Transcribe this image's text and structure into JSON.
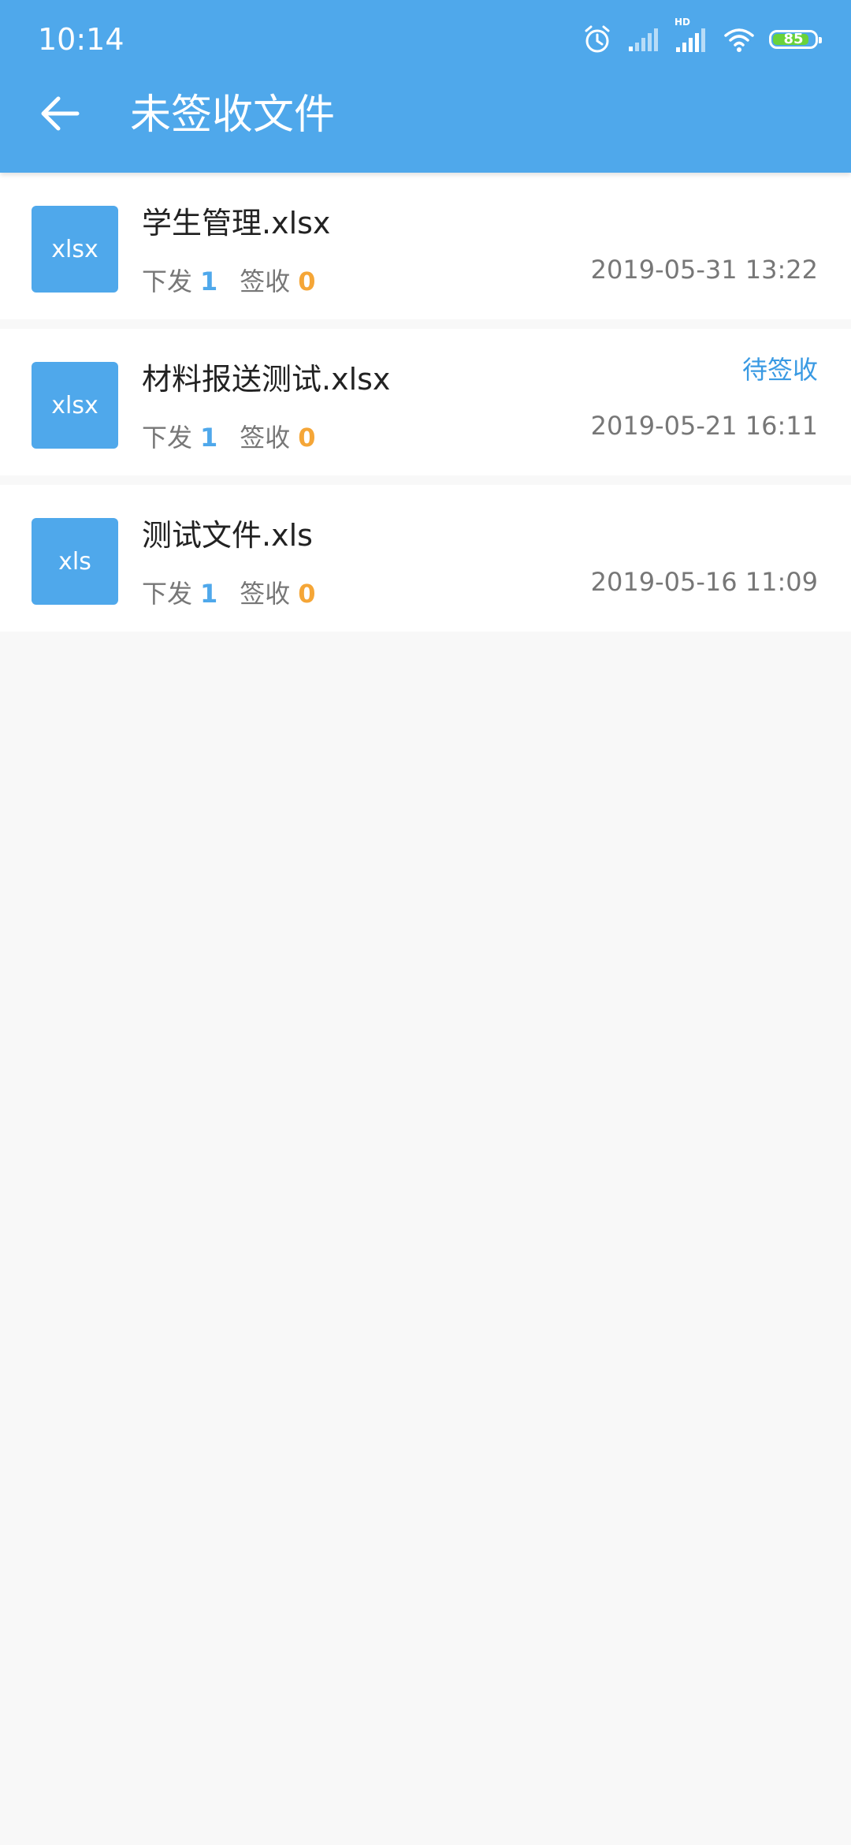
{
  "status_bar": {
    "time": "10:14",
    "battery": "85",
    "network_label": "HD"
  },
  "app_bar": {
    "title": "未签收文件"
  },
  "files": [
    {
      "type": "xlsx",
      "name": "学生管理.xlsx",
      "distribute_label": "下发",
      "distribute_count": "1",
      "sign_label": "签收",
      "sign_count": "0",
      "date": "2019-05-31 13:22",
      "status": ""
    },
    {
      "type": "xlsx",
      "name": "材料报送测试.xlsx",
      "distribute_label": "下发",
      "distribute_count": "1",
      "sign_label": "签收",
      "sign_count": "0",
      "date": "2019-05-21 16:11",
      "status": "待签收"
    },
    {
      "type": "xls",
      "name": "测试文件.xls",
      "distribute_label": "下发",
      "distribute_count": "1",
      "sign_label": "签收",
      "sign_count": "0",
      "date": "2019-05-16 11:09",
      "status": ""
    }
  ],
  "colors": {
    "primary": "#4fa8eb",
    "distribute_count": "#4fa8eb",
    "sign_count": "#f5a637",
    "status_text": "#3a9ae3",
    "battery_fill": "#6ad33a",
    "background": "#f8f8f8"
  },
  "icons": {
    "back": "arrow-left-icon",
    "alarm": "alarm-clock-icon",
    "signal": "cellular-signal-icon",
    "wifi": "wifi-icon",
    "battery": "battery-icon"
  }
}
